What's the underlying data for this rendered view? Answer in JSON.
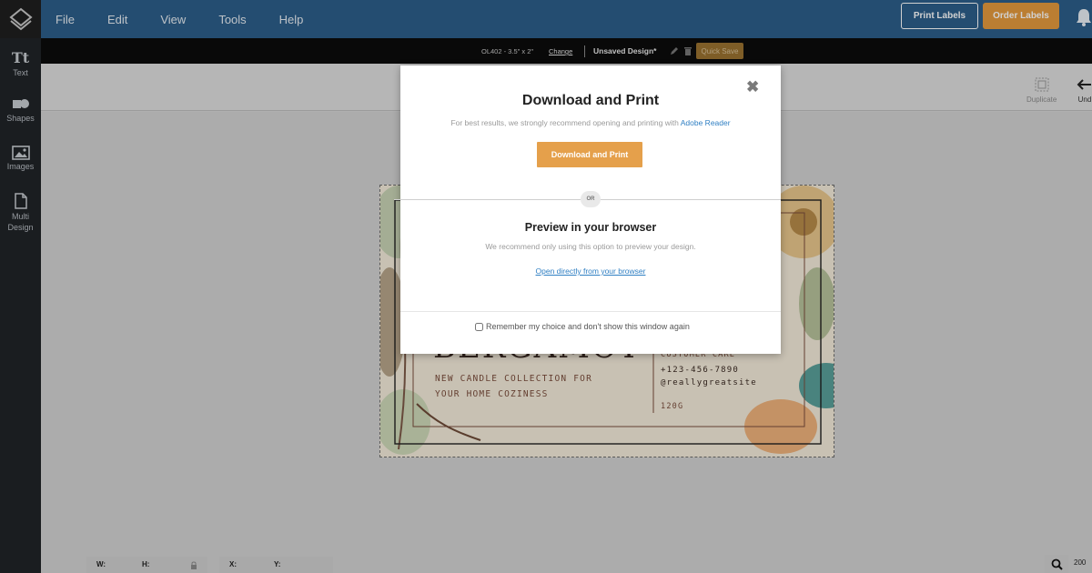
{
  "menu": [
    "File",
    "Edit",
    "View",
    "Tools",
    "Help"
  ],
  "header": {
    "print_labels": "Print Labels",
    "order_labels": "Order Labels"
  },
  "sidebar": [
    {
      "glyph": "Tt",
      "label": "Text",
      "icon": "text-icon"
    },
    {
      "glyph": "",
      "label": "Shapes",
      "icon": "shapes-icon"
    },
    {
      "glyph": "",
      "label": "Images",
      "icon": "image-icon"
    },
    {
      "glyph": "",
      "label": "Multi Design",
      "icon": "document-icon"
    }
  ],
  "infobar": {
    "size": "OL402 - 3.5\" x 2\"",
    "change": "Change",
    "design_name": "Unsaved Design*",
    "quick_save": "Quick Save"
  },
  "toolbar": {
    "duplicate": "Duplicate",
    "undo": "Und"
  },
  "card": {
    "title": "BERGAMOT",
    "line1": "NEW CANDLE COLLECTION FOR",
    "line2": "YOUR HOME COZINESS",
    "contact_heading": "CUSTOMER CARE",
    "phone": "+123-456-7890",
    "handle": "@reallygreatsite",
    "weight": "120G"
  },
  "bottom": {
    "w": "W:",
    "h": "H:",
    "x": "X:",
    "y": "Y:",
    "zoom": "200"
  },
  "modal": {
    "title": "Download and Print",
    "subtitle_prefix": "For best results, we strongly recommend opening and printing with ",
    "subtitle_link": "Adobe Reader",
    "download_button": "Download and Print",
    "or": "OR",
    "preview_title": "Preview in your browser",
    "preview_sub": "We recommend only using this option to preview your design.",
    "preview_link": "Open directly from your browser",
    "remember": "Remember my choice and don't show this window again"
  },
  "colors": {
    "topbar": "#2d5f8a",
    "accent_orange": "#e5a04b",
    "link_blue": "#2f7fc3"
  }
}
